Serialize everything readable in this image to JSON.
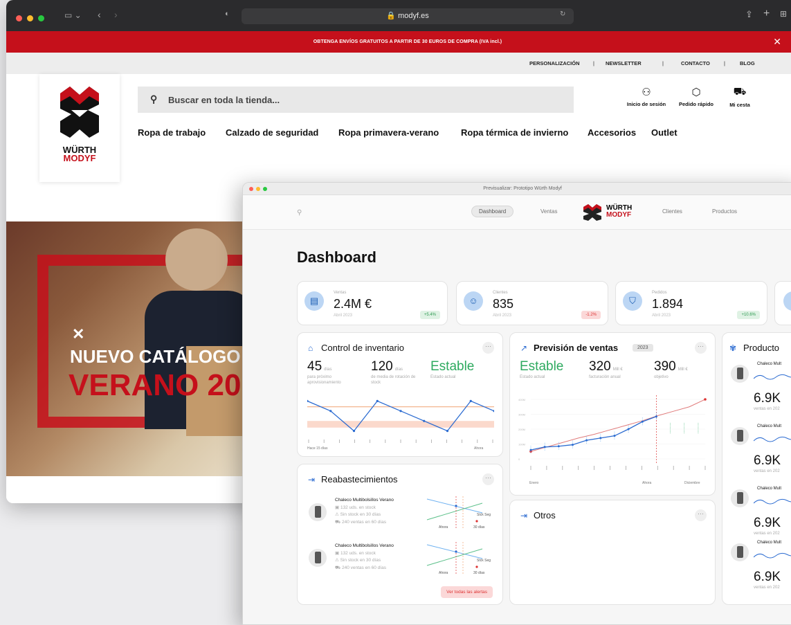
{
  "browser": {
    "url": "modyf.es",
    "promo": "OBTENGA ENVÍOS GRATUITOS A PARTIR DE 30 EUROS DE COMPRA (IVA incl.)",
    "close": "✕",
    "top_nav": [
      "PERSONALIZACIÓN",
      "|",
      "NEWSLETTER",
      "|",
      "CONTACTO",
      "|",
      "BLOG"
    ],
    "logo_text": [
      "WÜRTH",
      "MODYF"
    ],
    "search_placeholder": "Buscar en toda la tienda...",
    "user_actions": [
      {
        "label": "Inicio de sesión",
        "icon": "user-icon"
      },
      {
        "label": "Pedido rápido",
        "icon": "box-icon"
      },
      {
        "label": "Mi cesta",
        "icon": "cart-icon"
      }
    ],
    "categories": [
      "Ropa de trabajo",
      "Calzado de seguridad",
      "Ropa primavera-verano",
      "Ropa térmica de invierno",
      "Accesorios",
      "Outlet"
    ],
    "hero": {
      "line1": "NUEVO CATÁLOGO",
      "line2": "VERANO 20"
    }
  },
  "dashboard": {
    "window_title": "Previsualizar: Prototipo Würth Modyf",
    "nav": {
      "dashboard": "Dashboard",
      "ventas": "Ventas",
      "clientes": "Clientes",
      "productos": "Productos",
      "logo": [
        "WÜRTH",
        "MODYF"
      ]
    },
    "title": "Dashboard",
    "kpis": [
      {
        "label": "Ventas",
        "value": "2.4M €",
        "sub": "Abril 2023",
        "change": "+5.4%",
        "trend": "up",
        "icon": "register-icon"
      },
      {
        "label": "Clientes",
        "value": "835",
        "sub": "Abril 2023",
        "change": "-1.2%",
        "trend": "down",
        "icon": "user-circle-icon"
      },
      {
        "label": "Pedidos",
        "value": "1.894",
        "sub": "Abril 2023",
        "change": "+10.6%",
        "trend": "up",
        "icon": "bag-icon"
      }
    ],
    "inventory": {
      "title": "Control de inventario",
      "metrics": [
        {
          "value": "45",
          "unit": "días",
          "sub": "para próximo aprovisionamiento"
        },
        {
          "value": "120",
          "unit": "días",
          "sub": "de media de rotación de stock"
        },
        {
          "value": "Estable",
          "unit": "",
          "sub": "Estado actual"
        }
      ],
      "x_start": "Hace 15 días",
      "x_end": "Ahora",
      "series": [
        0.9,
        0.3,
        -0.9,
        0.9,
        0.3,
        -0.3,
        -0.9,
        0.9,
        0.3
      ],
      "ref_line": 0.55,
      "band": [
        -0.7,
        -0.3
      ]
    },
    "forecast": {
      "title": "Previsión de ventas",
      "year": "2023",
      "metrics": [
        {
          "value": "Estable",
          "unit": "",
          "sub": "Estado actual"
        },
        {
          "value": "320",
          "unit": "Mill €",
          "sub": "facturación anual"
        },
        {
          "value": "390",
          "unit": "Mill €",
          "sub": "objetivo"
        }
      ],
      "y_ticks": [
        "400M",
        "300M",
        "200M",
        "100M",
        "0"
      ],
      "x_labels": [
        "Enero",
        "Ahora",
        "Diciembre"
      ],
      "actual": [
        60,
        80,
        85,
        95,
        125,
        140,
        155,
        200,
        250,
        285
      ],
      "forecast_line": [
        50,
        80,
        110,
        140,
        165,
        195,
        225,
        255,
        290,
        320,
        350,
        400
      ]
    },
    "restock": {
      "title": "Reabastecimientos",
      "items": [
        {
          "name": "Chaleco Multibolsillos Verano",
          "stock": "132 uds. en stock",
          "out": "Sin stock en 30 días",
          "sales": "240 ventas en 60 días",
          "chart_labels": [
            "Ahora",
            "30 días",
            "Stck Seg"
          ]
        },
        {
          "name": "Chaleco Multibolsillos Verano",
          "stock": "132 uds. en stock",
          "out": "Sin stock en 30 días",
          "sales": "240 ventas en 60 días",
          "chart_labels": [
            "Ahora",
            "30 días",
            "Stck Seg"
          ]
        }
      ],
      "button": "Ver todas las alertas"
    },
    "otros": {
      "title": "Otros"
    },
    "products": {
      "title": "Producto",
      "items": [
        {
          "name": "Chaleco Mult",
          "value": "6.9K",
          "unit": "u",
          "sub": "ventas en 202"
        },
        {
          "name": "Chaleco Mult",
          "value": "6.9K",
          "unit": "u",
          "sub": "ventas en 202"
        },
        {
          "name": "Chaleco Mult",
          "value": "6.9K",
          "unit": "u",
          "sub": "ventas en 202"
        },
        {
          "name": "Chaleco Mult",
          "value": "6.9K",
          "unit": "u",
          "sub": "ventas en 202"
        }
      ]
    },
    "colors": {
      "accent": "#c5101b",
      "blue": "#2b6bd1",
      "green": "#2eaa5f",
      "orange": "#f0a070"
    }
  }
}
